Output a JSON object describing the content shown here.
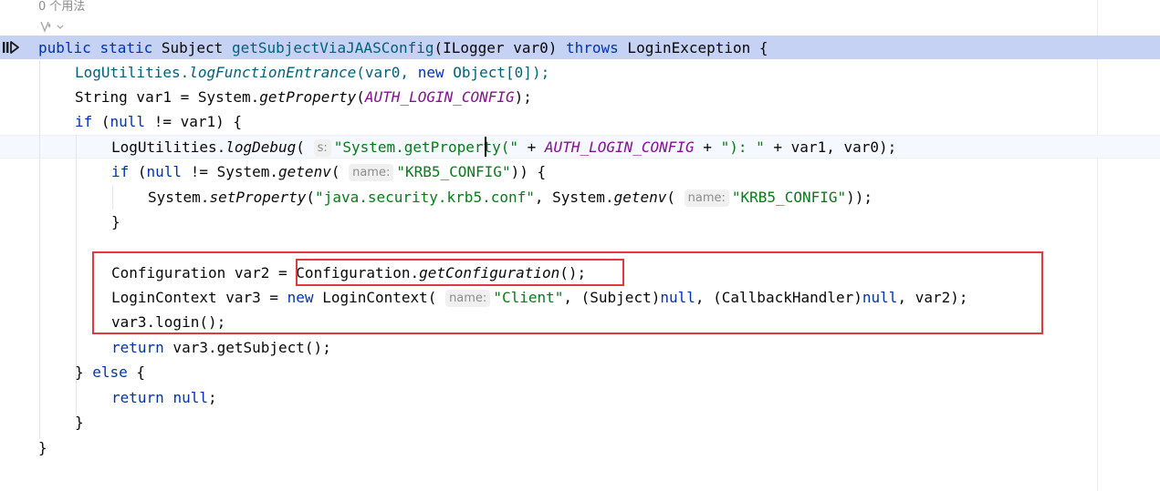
{
  "editor": {
    "usages_label": "0 个用法",
    "icons": {
      "gutter": "execution-point-icon",
      "inlay": "ai-assist-icon"
    },
    "colors": {
      "keyword": "#0033b3",
      "method": "#00627a",
      "string": "#067d17",
      "constant": "#871094",
      "execution_line": "#c6d2f3",
      "annotation_box": "#e0393e"
    },
    "hint_labels": {
      "s": "s:",
      "name": "name:"
    },
    "lines": [
      {
        "parts": [
          "public",
          "static",
          "Subject ",
          "getSubjectViaJAASConfig",
          "(ILogger var0) ",
          "throws",
          " LoginException {"
        ]
      },
      {
        "parts": [
          "LogUtilities.",
          "logFunctionEntrance",
          "(var0, ",
          "new",
          " Object[0]);"
        ]
      },
      {
        "parts": [
          "String var1 = System.",
          "getProperty",
          "(",
          "AUTH_LOGIN_CONFIG",
          ");"
        ]
      },
      {
        "parts": [
          "if",
          " (",
          "null",
          " != var1) {"
        ]
      },
      {
        "parts": [
          "LogUtilities.",
          "logDebug",
          "( ",
          "\"System.getProperty(\"",
          " + ",
          "AUTH_LOGIN_CONFIG",
          " + ",
          "\"): \"",
          " + var1, var0);"
        ]
      },
      {
        "parts": [
          "if",
          " (",
          "null",
          " != System.",
          "getenv",
          "( ",
          "\"KRB5_CONFIG\"",
          ")) {"
        ]
      },
      {
        "parts": [
          "System.",
          "setProperty",
          "(",
          "\"java.security.krb5.conf\"",
          ", System.",
          "getenv",
          "( ",
          "\"KRB5_CONFIG\"",
          "));"
        ]
      },
      {
        "parts": [
          "}"
        ]
      },
      {
        "parts": [
          "Configuration var2 = ",
          "Configuration.",
          "getConfiguration",
          "();"
        ]
      },
      {
        "parts": [
          "LoginContext var3 = ",
          "new",
          " LoginContext( ",
          "\"Client\"",
          ", (Subject)",
          "null",
          ", (CallbackHandler)",
          "null",
          ", var2);"
        ]
      },
      {
        "parts": [
          "var3.login();"
        ]
      },
      {
        "parts": [
          "return",
          " var3.getSubject();"
        ]
      },
      {
        "parts": [
          "} ",
          "else",
          " {"
        ]
      },
      {
        "parts": [
          "return",
          " ",
          "null",
          ";"
        ]
      },
      {
        "parts": [
          "}"
        ]
      },
      {
        "parts": [
          "}"
        ]
      }
    ]
  }
}
